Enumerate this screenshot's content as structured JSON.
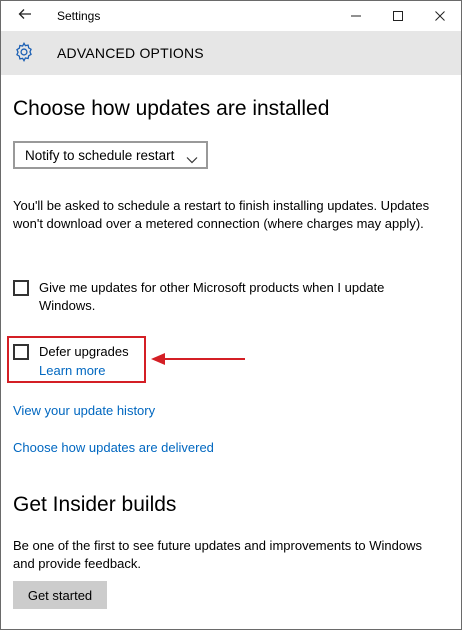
{
  "window": {
    "title": "Settings",
    "back_icon": "back-arrow-icon",
    "controls": [
      "minimize-icon",
      "maximize-icon",
      "close-icon"
    ]
  },
  "header": {
    "icon": "gear-icon",
    "title": "ADVANCED OPTIONS"
  },
  "updates": {
    "heading": "Choose how updates are installed",
    "dropdown": {
      "selected": "Notify to schedule restart"
    },
    "description": "You'll be asked to schedule a restart to finish installing updates. Updates won't download over a metered connection (where charges may apply).",
    "microsoft_products": {
      "label": "Give me updates for other Microsoft products when I update Windows.",
      "checked": false
    },
    "defer": {
      "label": "Defer upgrades",
      "checked": false,
      "learn_more": "Learn more"
    },
    "history_link": "View your update history",
    "delivery_link": "Choose how updates are delivered"
  },
  "insider": {
    "heading": "Get Insider builds",
    "description": "Be one of the first to see future updates and improvements to Windows and provide feedback.",
    "button": "Get started"
  },
  "colors": {
    "accent_link": "#0067c0",
    "header_bg": "#e6e6e6",
    "highlight": "#d41f25",
    "button_bg": "#cccccc"
  }
}
